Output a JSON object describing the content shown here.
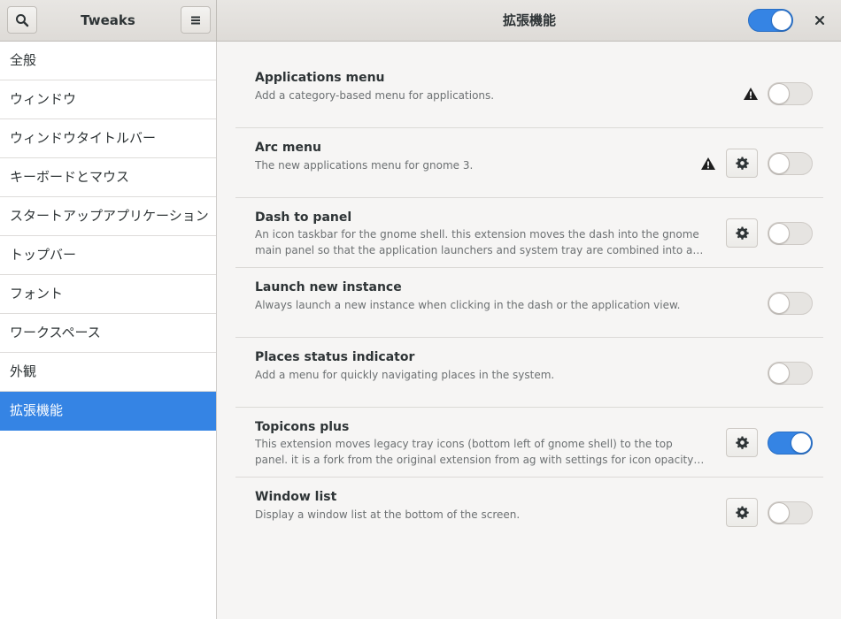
{
  "header": {
    "app_title": "Tweaks",
    "page_title": "拡張機能",
    "extensions_enabled": true
  },
  "sidebar": {
    "items": [
      {
        "label": "全般",
        "active": false
      },
      {
        "label": "ウィンドウ",
        "active": false
      },
      {
        "label": "ウィンドウタイトルバー",
        "active": false
      },
      {
        "label": "キーボードとマウス",
        "active": false
      },
      {
        "label": "スタートアップアプリケーション",
        "active": false
      },
      {
        "label": "トップバー",
        "active": false
      },
      {
        "label": "フォント",
        "active": false
      },
      {
        "label": "ワークスペース",
        "active": false
      },
      {
        "label": "外観",
        "active": false
      },
      {
        "label": "拡張機能",
        "active": true
      }
    ]
  },
  "extensions": [
    {
      "name": "Applications menu",
      "description": "Add a category-based menu for applications.",
      "warning": true,
      "settings": false,
      "enabled": false
    },
    {
      "name": "Arc menu",
      "description": "The new applications menu for gnome 3.",
      "warning": true,
      "settings": true,
      "enabled": false
    },
    {
      "name": "Dash to panel",
      "description": "An icon taskbar for the gnome shell. this extension moves the dash into the gnome main panel so that the application launchers and system tray are combined into a single panel, si…",
      "warning": false,
      "settings": true,
      "enabled": false
    },
    {
      "name": "Launch new instance",
      "description": "Always launch a new instance when clicking in the dash or the application view.",
      "warning": false,
      "settings": false,
      "enabled": false
    },
    {
      "name": "Places status indicator",
      "description": "Add a menu for quickly navigating places in the system.",
      "warning": false,
      "settings": false,
      "enabled": false
    },
    {
      "name": "Topicons plus",
      "description": "This extension moves legacy tray icons (bottom left of gnome shell) to the top panel. it is a fork from the original extension from ag  with settings for icon opacity, saturation, padding, …",
      "warning": false,
      "settings": true,
      "enabled": true
    },
    {
      "name": "Window list",
      "description": "Display a window list at the bottom of the screen.",
      "warning": false,
      "settings": true,
      "enabled": false
    }
  ],
  "icons": {
    "search": "search-icon",
    "menu": "hamburger-menu-icon",
    "close": "close-icon",
    "warning": "warning-icon",
    "settings": "gear-icon"
  },
  "colors": {
    "accent": "#3584e4",
    "text": "#2e3436",
    "subtext": "#6c7072"
  }
}
